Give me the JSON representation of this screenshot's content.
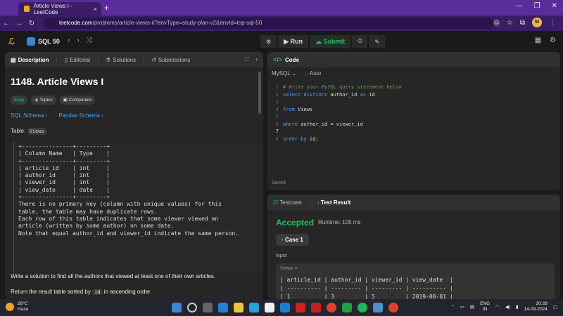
{
  "browser": {
    "tab_title": "Article Views I - LeetCode",
    "tab_close": "×",
    "new_tab": "+",
    "url_site": "leetcode.com",
    "url_path": "/problems/article-views-i/?envType=study-plan-v2&envId=top-sql-50",
    "avatar_letter": "M"
  },
  "topbar": {
    "study_plan": "SQL 50",
    "run_label": "Run",
    "submit_label": "Submit"
  },
  "problem_tabs": [
    {
      "label": "Description",
      "icon": "document-icon"
    },
    {
      "label": "Editorial",
      "icon": "book-icon"
    },
    {
      "label": "Solutions",
      "icon": "flask-icon"
    },
    {
      "label": "Submissions",
      "icon": "history-icon"
    }
  ],
  "problem": {
    "title": "1148. Article Views I",
    "difficulty": "Easy",
    "topics_label": "Topics",
    "companies_label": "Companies",
    "sql_schema_link": "SQL Schema",
    "pandas_schema_link": "Pandas Schema",
    "table_prefix": "Table:",
    "table_name": "Views",
    "schema_text": "+---------------+---------+\n| Column Name   | Type    |\n+---------------+---------+\n| article_id    | int     |\n| author_id     | int     |\n| viewer_id     | int     |\n| view_date     | date    |\n+---------------+---------+\nThere is no primary key (column with unique values) for this\ntable, the table may have duplicate rows.\nEach row of this table indicates that some viewer viewed an\narticle (written by some author) on some date.\nNote that equal author_id and viewer_id indicate the same person.",
    "description_1": "Write a solution to find all the authors that viewed at least one of their own articles.",
    "description_2_prefix": "Return the result table sorted by",
    "description_2_code": "id",
    "description_2_suffix": "in ascending order."
  },
  "code_panel": {
    "title": "Code",
    "language": "MySQL",
    "autocomplete": "Auto",
    "saved_status": "Saved",
    "lines": [
      {
        "n": "1",
        "text": "# Write your MySQL query statement below"
      },
      {
        "n": "2",
        "text": "select distinct author_id as id"
      },
      {
        "n": "3",
        "text": ""
      },
      {
        "n": "4",
        "text": "from Views"
      },
      {
        "n": "5",
        "text": ""
      },
      {
        "n": "6",
        "text": "where author_id = viewer_id"
      },
      {
        "n": "7",
        "text": ""
      },
      {
        "n": "8",
        "text": "order by id;"
      }
    ]
  },
  "result_panel": {
    "testcase_tab": "Testcase",
    "result_tab": "Test Result",
    "status": "Accepted",
    "runtime": "Runtime: 105 ms",
    "case_label": "Case 1",
    "input_label": "Input",
    "views_label": "Views =",
    "input_table": "| article_id | author_id | viewer_id | view_date  |\n| ---------- | --------- | --------- | ---------- |\n| 1          | 3         | 5         | 2019-08-01 |"
  },
  "taskbar": {
    "temperature": "28°C",
    "weather": "Haze",
    "lang_top": "ENG",
    "lang_bottom": "IN",
    "time": "20:28",
    "date": "14-09-2024"
  },
  "colors": {
    "accepted": "#2cbb5d",
    "link": "#4aa3ff",
    "easy": "#1cb8b8",
    "browser_chrome": "#5b2d9a"
  }
}
